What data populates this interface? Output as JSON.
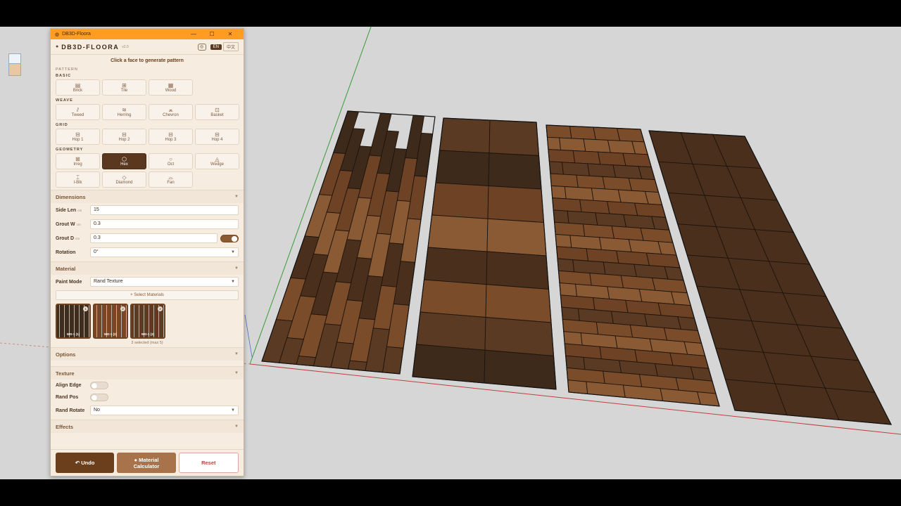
{
  "window": {
    "title": "DB3D-Floora",
    "minimize_glyph": "—",
    "maximize_glyph": "☐",
    "close_glyph": "✕"
  },
  "header": {
    "brand": "DB3D-FLOORA",
    "version": "v2.0",
    "lang_en": "EN",
    "lang_other": "中文"
  },
  "hint": "Click a face to generate pattern",
  "pattern": {
    "section_label": "PATTERN",
    "groups": [
      {
        "label": "BASIC",
        "items": [
          {
            "label": "Brick",
            "icon": "▤"
          },
          {
            "label": "Tile",
            "icon": "⊞"
          },
          {
            "label": "Wood",
            "icon": "▦"
          }
        ]
      },
      {
        "label": "WEAVE",
        "items": [
          {
            "label": "Tweed",
            "icon": "⫽"
          },
          {
            "label": "Herring",
            "icon": "≋"
          },
          {
            "label": "Chevron",
            "icon": "⩕"
          },
          {
            "label": "Basket",
            "icon": "⊡"
          }
        ]
      },
      {
        "label": "GRID",
        "items": [
          {
            "label": "Hop 1",
            "icon": "⊟"
          },
          {
            "label": "Hop 2",
            "icon": "⊟"
          },
          {
            "label": "Hop 3",
            "icon": "⊟"
          },
          {
            "label": "Hop 4",
            "icon": "⊟"
          }
        ]
      },
      {
        "label": "GEOMETRY",
        "items": [
          {
            "label": "Irreg",
            "icon": "⊠"
          },
          {
            "label": "Hex",
            "icon": "⬡",
            "active": true
          },
          {
            "label": "Oct",
            "icon": "○"
          },
          {
            "label": "Wedge",
            "icon": "◬"
          },
          {
            "label": "I-Blk",
            "icon": "⌶"
          },
          {
            "label": "Diamond",
            "icon": "◇"
          },
          {
            "label": "Fan",
            "icon": "⌓"
          }
        ]
      }
    ]
  },
  "dimensions": {
    "title": "Dimensions",
    "side_len": {
      "label": "Side Len",
      "unit": "cm",
      "value": "15"
    },
    "grout_w": {
      "label": "Grout W",
      "unit": "cm",
      "value": "0.3"
    },
    "grout_d": {
      "label": "Grout D",
      "unit": "cm",
      "value": "0.3",
      "enabled": true
    },
    "rotation": {
      "label": "Rotation",
      "value": "0°"
    }
  },
  "material": {
    "title": "Material",
    "paint_mode_label": "Paint Mode",
    "paint_mode_value": "Rand Texture",
    "select_button": "+ Select Materials",
    "thumbs": [
      {
        "label": "WD-1 (1)",
        "num": "1",
        "color": "#3e2c1c"
      },
      {
        "label": "WD-1 (2)",
        "num": "2",
        "color": "#7a4524"
      },
      {
        "label": "WD-1 (3)",
        "num": "3",
        "color": "#5e3a22"
      }
    ],
    "selected_count": "3 selected (max 5)"
  },
  "options": {
    "title": "Options"
  },
  "texture": {
    "title": "Texture",
    "align_edge": "Align Edge",
    "rand_pos": "Rand Pos",
    "rand_rotate_label": "Rand Rotate",
    "rand_rotate_value": "No"
  },
  "effects": {
    "title": "Effects"
  },
  "footer": {
    "undo": "↶ Undo",
    "calc_line1": "Material",
    "calc_line2": "Calculator",
    "reset": "Reset"
  },
  "colors": {
    "titlebar": "#ff9c24",
    "accent": "#5a3820",
    "wood_dark": "#3e2a1a",
    "wood_mid": "#6e4224",
    "wood_light": "#8a5a34"
  }
}
